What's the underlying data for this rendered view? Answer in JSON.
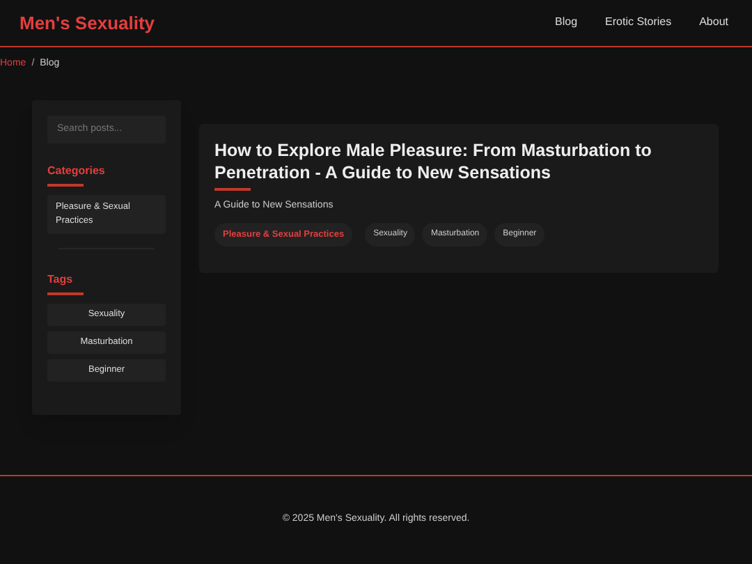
{
  "site_title": "Men's Sexuality",
  "nav": [
    {
      "label": "Blog"
    },
    {
      "label": "Erotic Stories"
    },
    {
      "label": "About"
    }
  ],
  "breadcrumb": [
    {
      "label": "Home",
      "link": true
    },
    {
      "label": "Blog",
      "link": false
    }
  ],
  "breadcrumb_separator": "/",
  "sidebar": {
    "search": {
      "placeholder": "Search posts..."
    },
    "categories_heading": "Categories",
    "categories": [
      "Pleasure & Sexual Practices"
    ],
    "tags_heading": "Tags",
    "tags": [
      "Sexuality",
      "Masturbation",
      "Beginner"
    ]
  },
  "post": {
    "title": "How to Explore Male Pleasure: From Masturbation to Penetration - A Guide to New Sensations",
    "subtitle": "A Guide to New Sensations",
    "category": "Pleasure & Sexual Practices",
    "tags": [
      "Sexuality",
      "Masturbation",
      "Beginner"
    ]
  },
  "footer": "© 2025 Men's Sexuality. All rights reserved."
}
